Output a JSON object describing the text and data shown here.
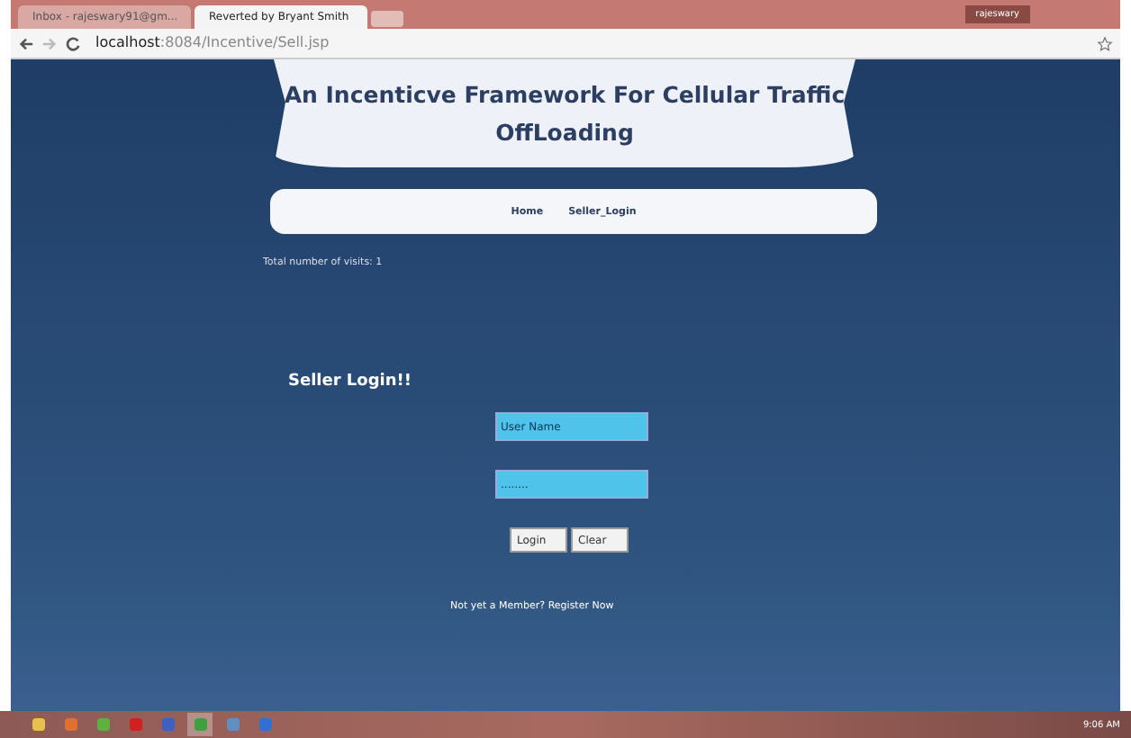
{
  "browser": {
    "tabs": [
      {
        "label": "Inbox - rajeswary91@gm...",
        "selected": false
      },
      {
        "label": "Reverted by Bryant Smith",
        "selected": true
      }
    ],
    "user": "rajeswary",
    "address": {
      "host": "localhost",
      "rest": ":8084/Incentive/Sell.jsp"
    }
  },
  "page": {
    "title": "An Incenticve Framework For Cellular Traffic OffLoading",
    "nav": [
      "Home",
      "Seller_Login"
    ],
    "visits": "Total number of visits: 1",
    "heading": "Seller Login!!",
    "fields": [
      {
        "placeholder": "User Name"
      },
      {
        "value": "........"
      }
    ],
    "buttons": [
      "Login",
      "Clear"
    ],
    "footer": "Not yet a Member? Register Now"
  },
  "taskbar": {
    "clock": "9:06 AM"
  }
}
